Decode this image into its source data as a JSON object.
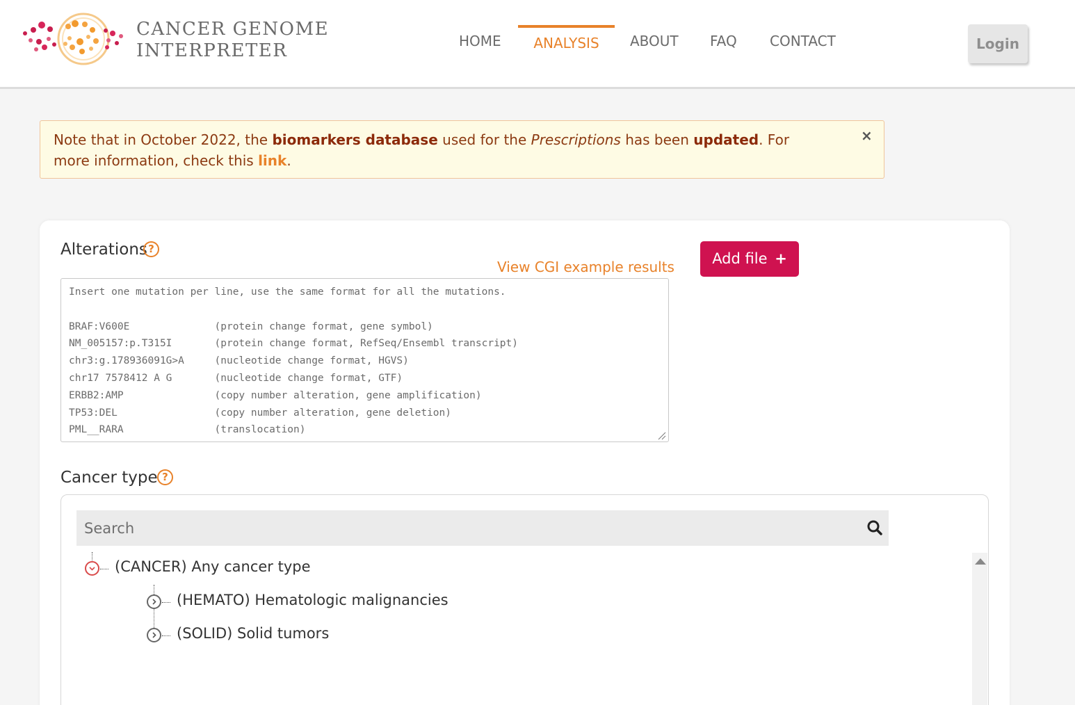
{
  "header": {
    "logo_line1": "CANCER GENOME",
    "logo_line2": "INTERPRETER",
    "nav": [
      {
        "label": "HOME"
      },
      {
        "label": "ANALYSIS",
        "active": true
      },
      {
        "label": "ABOUT"
      },
      {
        "label": "FAQ"
      },
      {
        "label": "CONTACT"
      }
    ],
    "login_label": "Login"
  },
  "alert": {
    "t1": "Note that in October 2022, the ",
    "b1": "biomarkers database",
    "t2": " used for the ",
    "i1": "Prescriptions",
    "t3": " has been ",
    "b2": "updated",
    "t4": ". For more information, check this ",
    "link": "link",
    "t5": ".",
    "close": "×"
  },
  "alterations": {
    "label": "Alterations",
    "help": "?",
    "example_link": "View CGI example results",
    "add_file_label": "Add file",
    "add_file_icon": "+",
    "placeholder": "Insert one mutation per line, use the same format for all the mutations.\n\nBRAF:V600E              (protein change format, gene symbol)\nNM_005157:p.T315I       (protein change format, RefSeq/Ensembl transcript)\nchr3:g.178936091G>A     (nucleotide change format, HGVS)\nchr17 7578412 A G       (nucleotide change format, GTF)\nERBB2:AMP               (copy number alteration, gene amplification)\nTP53:DEL                (copy number alteration, gene deletion)\nPML__RARA               (translocation)"
  },
  "cancer_type": {
    "label": "Cancer type",
    "help": "?",
    "search_placeholder": "Search",
    "tree": [
      {
        "label": "(CANCER) Any cancer type",
        "expanded": true
      },
      {
        "label": "(HEMATO) Hematologic malignancies",
        "expanded": false
      },
      {
        "label": "(SOLID) Solid tumors",
        "expanded": false
      }
    ]
  },
  "colors": {
    "accent": "#e8822a",
    "primary_button": "#cf1250",
    "alert_bg": "#fefbe4"
  }
}
